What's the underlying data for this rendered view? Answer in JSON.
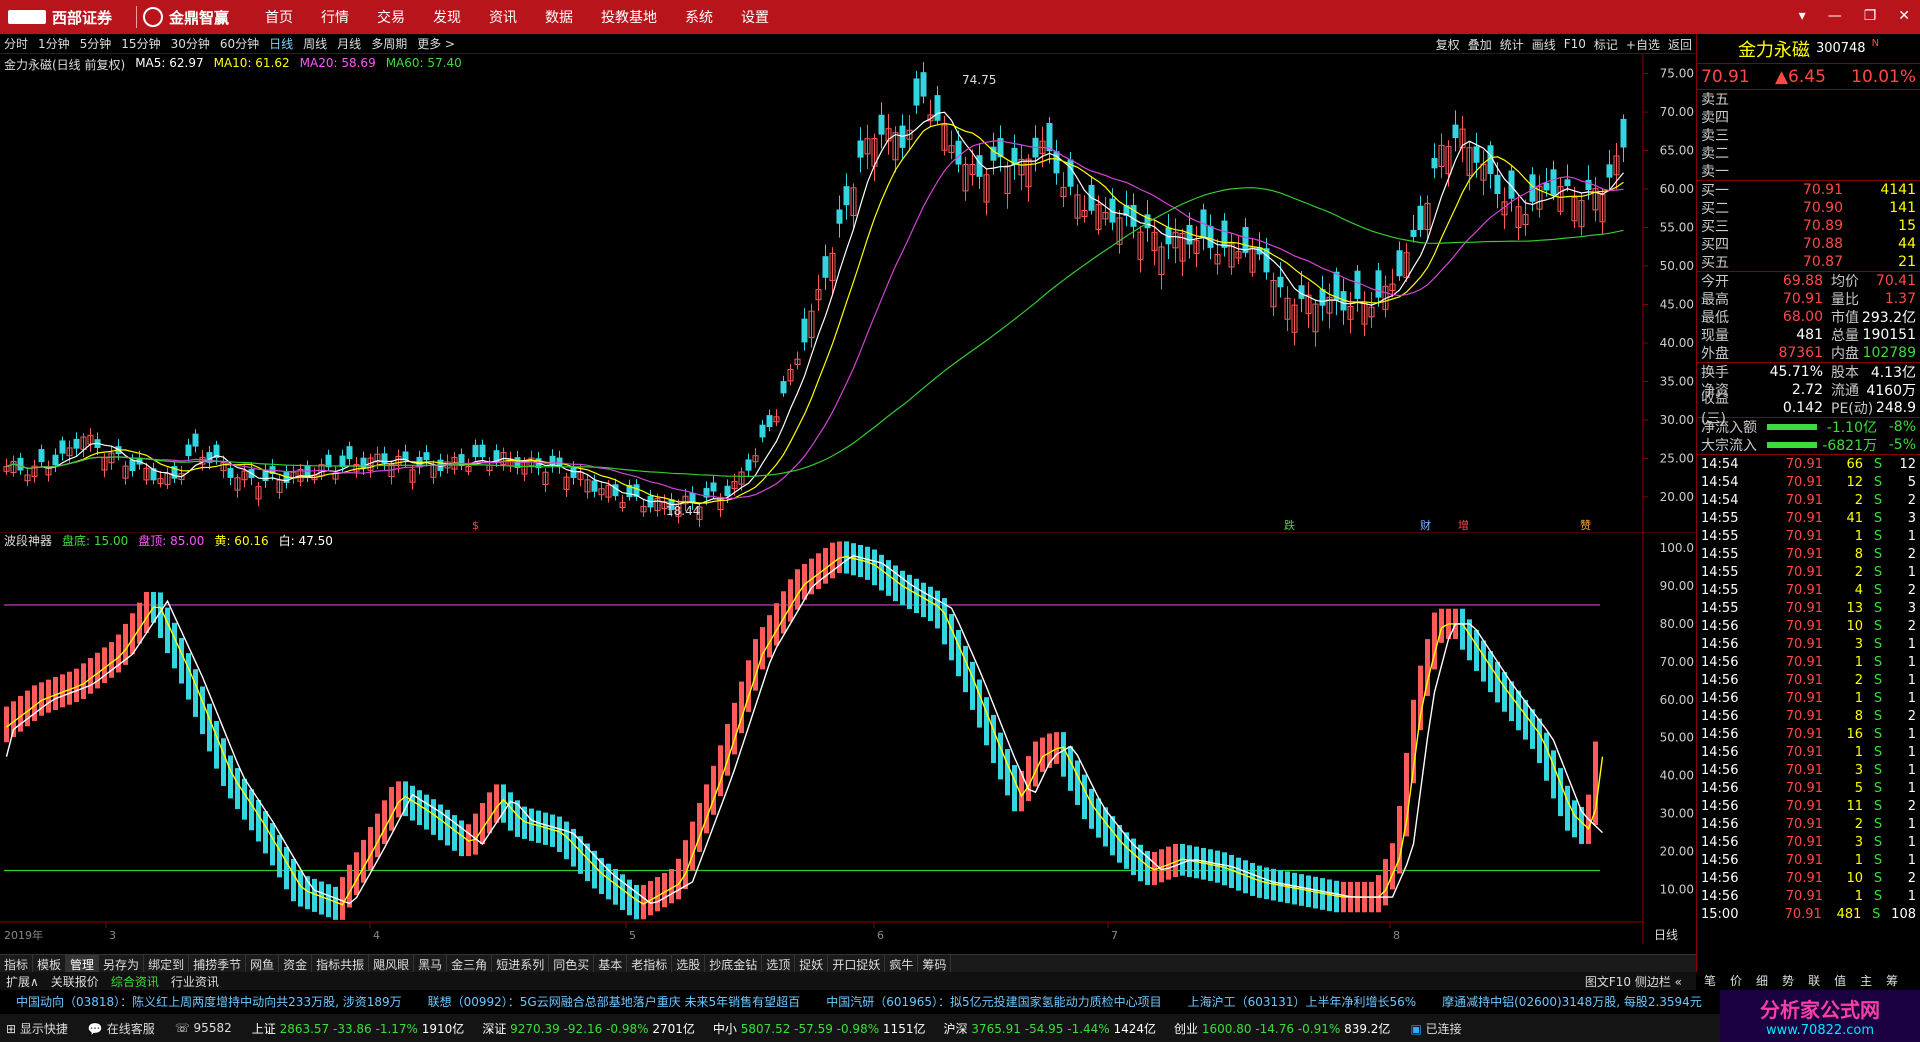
{
  "topbar": {
    "brand1": "西部证券",
    "brand2": "金鼎智赢",
    "menu": [
      "首页",
      "行情",
      "交易",
      "发现",
      "资讯",
      "数据",
      "投教基地",
      "系统",
      "设置"
    ],
    "controls": [
      "▾",
      "—",
      "❐",
      "✕"
    ]
  },
  "periodbar": {
    "items": [
      "分时",
      "1分钟",
      "5分钟",
      "15分钟",
      "30分钟",
      "60分钟",
      "日线",
      "周线",
      "月线",
      "多周期",
      "更多 >"
    ],
    "active": "日线",
    "tools": [
      "复权",
      "叠加",
      "统计",
      "画线",
      "F10",
      "标记",
      "+自选",
      "返回"
    ]
  },
  "main_legend": {
    "title": "金力永磁(日线 前复权)",
    "ma5": "MA5: 62.97",
    "ma10": "MA10: 61.62",
    "ma20": "MA20: 58.69",
    "ma60": "MA60: 57.40"
  },
  "main_axis": [
    "75.00",
    "70.00",
    "65.00",
    "60.00",
    "55.00",
    "50.00",
    "45.00",
    "40.00",
    "35.00",
    "30.00",
    "25.00",
    "20.00"
  ],
  "main_annotations": {
    "high": "74.75",
    "low": "18.44",
    "markers": [
      "$",
      "跌",
      "财",
      "增",
      "赞"
    ]
  },
  "ind_legend": {
    "title": "波段神器",
    "bottom": "盘底: 15.00",
    "top": "盘顶: 85.00",
    "yellow": "黄: 60.16",
    "white": "白: 47.50"
  },
  "ind_axis": [
    "100.0",
    "90.00",
    "80.00",
    "70.00",
    "60.00",
    "50.00",
    "40.00",
    "30.00",
    "20.00",
    "10.00"
  ],
  "date_axis": {
    "year": "2019年",
    "months": [
      "3",
      "4",
      "5",
      "6",
      "7",
      "8"
    ],
    "period": "日线"
  },
  "tabs": [
    "指标",
    "模板",
    "管理",
    "另存为",
    "绑定到",
    "捕捞季节",
    "网鱼",
    "资金",
    "指标共振",
    "飓风眼",
    "黑马",
    "金三角",
    "短进系列",
    "同色买",
    "基本",
    "老指标",
    "选股",
    "抄底金钻",
    "选顶",
    "捉妖",
    "开口捉妖",
    "疯牛",
    "筹码"
  ],
  "tabs_active": "管理",
  "tabs2": [
    "扩展∧",
    "关联报价",
    "综合资讯",
    "行业资讯"
  ],
  "tabs2_right": "图文F10 侧边栏 «",
  "news": [
    "中国动向（03818）：陈义红上周两度增持中动向共233万股, 涉资189万",
    "联想（00992）：5G云网融合总部基地落户重庆 未来5年销售有望超百",
    "中国汽研（601965）：拟5亿元投建国家氢能动力质检中心项目",
    "上海沪工（603131）上半年净利增长56%",
    "摩通减持中铝(02600)3148万股, 每股2.3594元"
  ],
  "status": {
    "quick": "显示快捷",
    "service": "在线客服",
    "phone": "95582",
    "indices": [
      {
        "name": "上证",
        "val": "2863.57",
        "chg": "-33.86",
        "pct": "-1.17%",
        "amt": "1910亿"
      },
      {
        "name": "深证",
        "val": "9270.39",
        "chg": "-92.16",
        "pct": "-0.98%",
        "amt": "2701亿"
      },
      {
        "name": "中小",
        "val": "5807.52",
        "chg": "-57.59",
        "pct": "-0.98%",
        "amt": "1151亿"
      },
      {
        "name": "沪深",
        "val": "3765.91",
        "chg": "-54.95",
        "pct": "-1.44%",
        "amt": "1424亿"
      },
      {
        "name": "创业",
        "val": "1600.80",
        "chg": "-14.76",
        "pct": "-0.91%",
        "amt": "839.2亿"
      }
    ],
    "conn": "已连接"
  },
  "stock": {
    "name": "金力永磁",
    "code": "300748",
    "flag": "N",
    "price": "70.91",
    "chg": "▲6.45",
    "pct": "10.01%",
    "asks": [
      "卖五",
      "卖四",
      "卖三",
      "卖二",
      "卖一"
    ],
    "bids": [
      {
        "l": "买一",
        "p": "70.91",
        "v": "4141"
      },
      {
        "l": "买二",
        "p": "70.90",
        "v": "141"
      },
      {
        "l": "买三",
        "p": "70.89",
        "v": "15"
      },
      {
        "l": "买四",
        "p": "70.88",
        "v": "44"
      },
      {
        "l": "买五",
        "p": "70.87",
        "v": "21"
      }
    ],
    "stats": [
      {
        "l1": "今开",
        "v1": "69.88",
        "l2": "均价",
        "v2": "70.41"
      },
      {
        "l1": "最高",
        "v1": "70.91",
        "l2": "量比",
        "v2": "1.37"
      },
      {
        "l1": "最低",
        "v1": "68.00",
        "l2": "市值",
        "v2": "293.2亿"
      },
      {
        "l1": "现量",
        "v1": "481",
        "l2": "总量",
        "v2": "190151"
      },
      {
        "l1": "外盘",
        "v1": "87361",
        "l2": "内盘",
        "v2": "102789"
      }
    ],
    "stats2": [
      {
        "l1": "换手",
        "v1": "45.71%",
        "l2": "股本",
        "v2": "4.13亿"
      },
      {
        "l1": "净资",
        "v1": "2.72",
        "l2": "流通",
        "v2": "4160万"
      },
      {
        "l1": "收益(三)",
        "v1": "0.142",
        "l2": "PE(动)",
        "v2": "248.9"
      }
    ],
    "flows": [
      {
        "l": "净流入额",
        "v": "-1.10亿",
        "p": "-8%"
      },
      {
        "l": "大宗流入",
        "v": "-6821万",
        "p": "-5%"
      }
    ],
    "ticks": [
      [
        "14:54",
        "70.91",
        "66",
        "S",
        "12"
      ],
      [
        "14:54",
        "70.91",
        "12",
        "S",
        "5"
      ],
      [
        "14:54",
        "70.91",
        "2",
        "S",
        "2"
      ],
      [
        "14:55",
        "70.91",
        "41",
        "S",
        "3"
      ],
      [
        "14:55",
        "70.91",
        "1",
        "S",
        "1"
      ],
      [
        "14:55",
        "70.91",
        "8",
        "S",
        "2"
      ],
      [
        "14:55",
        "70.91",
        "2",
        "S",
        "1"
      ],
      [
        "14:55",
        "70.91",
        "4",
        "S",
        "2"
      ],
      [
        "14:55",
        "70.91",
        "13",
        "S",
        "3"
      ],
      [
        "14:56",
        "70.91",
        "10",
        "S",
        "2"
      ],
      [
        "14:56",
        "70.91",
        "3",
        "S",
        "1"
      ],
      [
        "14:56",
        "70.91",
        "1",
        "S",
        "1"
      ],
      [
        "14:56",
        "70.91",
        "2",
        "S",
        "1"
      ],
      [
        "14:56",
        "70.91",
        "1",
        "S",
        "1"
      ],
      [
        "14:56",
        "70.91",
        "8",
        "S",
        "2"
      ],
      [
        "14:56",
        "70.91",
        "16",
        "S",
        "1"
      ],
      [
        "14:56",
        "70.91",
        "1",
        "S",
        "1"
      ],
      [
        "14:56",
        "70.91",
        "3",
        "S",
        "1"
      ],
      [
        "14:56",
        "70.91",
        "5",
        "S",
        "1"
      ],
      [
        "14:56",
        "70.91",
        "11",
        "S",
        "2"
      ],
      [
        "14:56",
        "70.91",
        "2",
        "S",
        "1"
      ],
      [
        "14:56",
        "70.91",
        "3",
        "S",
        "1"
      ],
      [
        "14:56",
        "70.91",
        "1",
        "S",
        "1"
      ],
      [
        "14:56",
        "70.91",
        "10",
        "S",
        "2"
      ],
      [
        "14:56",
        "70.91",
        "1",
        "S",
        "1"
      ],
      [
        "15:00",
        "70.91",
        "481",
        "S",
        "108"
      ]
    ],
    "rp_tabs": [
      "笔",
      "价",
      "细",
      "势",
      "联",
      "值",
      "主",
      "筹"
    ]
  },
  "brand": {
    "cn": "分析家公式网",
    "url": "www.70822.com"
  },
  "colors": {
    "up": "#ff5a5a",
    "down": "#33d6e0",
    "ma5": "#ffffff",
    "ma10": "#ffff00",
    "ma20": "#d444d4",
    "ma60": "#33cc33",
    "bg": "#000000"
  }
}
